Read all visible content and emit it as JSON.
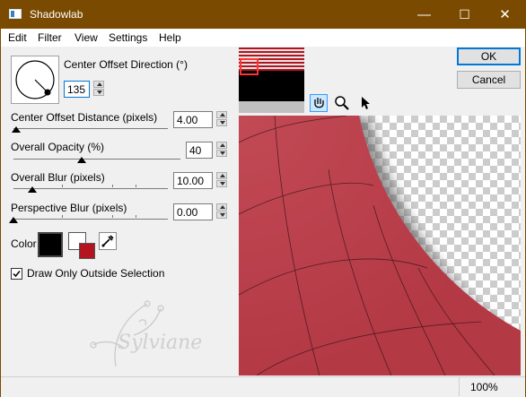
{
  "window": {
    "title": "Shadowlab",
    "minimize": "—",
    "maximize": "☐",
    "close": "✕"
  },
  "menu": [
    "Edit",
    "Filter",
    "View",
    "Settings",
    "Help"
  ],
  "controls": {
    "direction_label": "Center Offset Direction (°)",
    "direction_value": "135",
    "distance_label": "Center Offset Distance (pixels)",
    "distance_value": "4.00",
    "opacity_label": "Overall Opacity (%)",
    "opacity_value": "40",
    "blur_label": "Overall Blur (pixels)",
    "blur_value": "10.00",
    "pblur_label": "Perspective Blur (pixels)",
    "pblur_value": "0.00",
    "color_label": "Color",
    "checkbox_label": "Draw Only Outside Selection",
    "checkbox_checked": true
  },
  "colors": {
    "shadow": "#000000",
    "fill": "#b3141f",
    "titlebar": "#7a4a00"
  },
  "buttons": {
    "ok": "OK",
    "cancel": "Cancel"
  },
  "tools": [
    "hand-icon",
    "zoom-icon",
    "arrow-icon"
  ],
  "watermark": "Sylviane",
  "status": {
    "zoom": "100%"
  }
}
